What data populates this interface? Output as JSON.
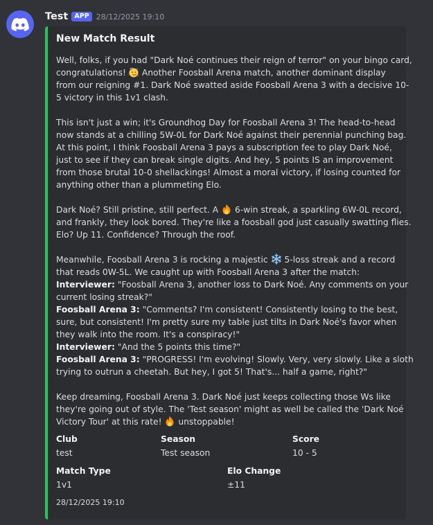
{
  "bot": {
    "username": "Test",
    "badge": "APP",
    "timestamp": "28/12/2025 19:10",
    "avatar_icon": "discord-logo-icon",
    "avatar_color": "#5865f2"
  },
  "embed": {
    "accent_color": "#22c55e",
    "title": "New Match Result",
    "paragraph1": {
      "line1": "Well, folks, if you had \"Dark Noé continues their reign of terror\" on your bingo card,",
      "line2": "congratulations!",
      "line2_emoji": "partying-face-icon",
      "line2_rest": " Another Foosball Arena match, another dominant display",
      "line3": "from our reigning #1. Dark Noé swatted aside Foosball Arena 3 with a decisive 10-",
      "line4": "5 victory in this 1v1 clash."
    },
    "paragraph2": {
      "line1": "This isn't just a win; it's Groundhog Day for Foosball Arena 3! The head-to-head",
      "line2": "now stands at a chilling 5W-0L for Dark Noé against their perennial punching bag.",
      "line3": "At this point, I think Foosball Arena 3 pays a subscription fee to play Dark Noé,",
      "line4": "just to see if they can break single digits. And hey, 5 points IS an improvement",
      "line5": "from those brutal 10-0 shellackings! Almost a moral victory, if losing counted for",
      "line6": "anything other than a plummeting Elo."
    },
    "paragraph3": {
      "line1_a": "Dark Noé? Still pristine, still perfect. A ",
      "line1_emoji": "fire-icon",
      "line1_b": " 6-win streak, a sparkling 6W-0L record,",
      "line2": "and frankly, they look bored. They're like a foosball god just casually swatting flies.",
      "line3": "Elo? Up 11. Confidence? Through the roof."
    },
    "paragraph4": {
      "line1_a": "Meanwhile, Foosball Arena 3 is rocking a majestic ",
      "line1_emoji": "snowflake-icon",
      "line1_b": " 5-loss streak and a record",
      "line2": "that reads 0W-5L. We caught up with Foosball Arena 3 after the match:",
      "q1_speaker": "Interviewer:",
      "q1_line1": " \"Foosball Arena 3, another loss to Dark Noé. Any comments on your",
      "q1_line2": "current losing streak?\"",
      "a1_speaker": "Foosball Arena 3:",
      "a1_line1": " \"Comments? I'm consistent! Consistently losing to the best,",
      "a1_line2": "sure, but consistent! I'm pretty sure my table just tilts in Dark Noé's favor when",
      "a1_line3": "they walk into the room. It's a conspiracy!\"",
      "q2_speaker": "Interviewer:",
      "q2_line1": " \"And the 5 points this time?\"",
      "a2_speaker": "Foosball Arena 3:",
      "a2_line1": " \"PROGRESS! I'm evolving! Slowly. Very, very slowly. Like a sloth",
      "a2_line2": "trying to outrun a cheetah. But hey, I got 5! That's... half a game, right?\""
    },
    "paragraph5": {
      "line1": "Keep dreaming, Foosball Arena 3. Dark Noé just keeps collecting those Ws like",
      "line2": "they're going out of style. The 'Test season' might as well be called the 'Dark Noé",
      "line3_a": "Victory Tour' at this rate! ",
      "line3_emoji": "fire-icon",
      "line3_b": " unstoppable!"
    },
    "fields": {
      "club_name": "Club",
      "club_value": "test",
      "season_name": "Season",
      "season_value": "Test season",
      "score_name": "Score",
      "score_value": "10 - 5",
      "match_type_name": "Match Type",
      "match_type_value": "1v1",
      "elo_change_name": "Elo Change",
      "elo_change_value": "±11"
    },
    "footer": "28/12/2025 19:10"
  }
}
